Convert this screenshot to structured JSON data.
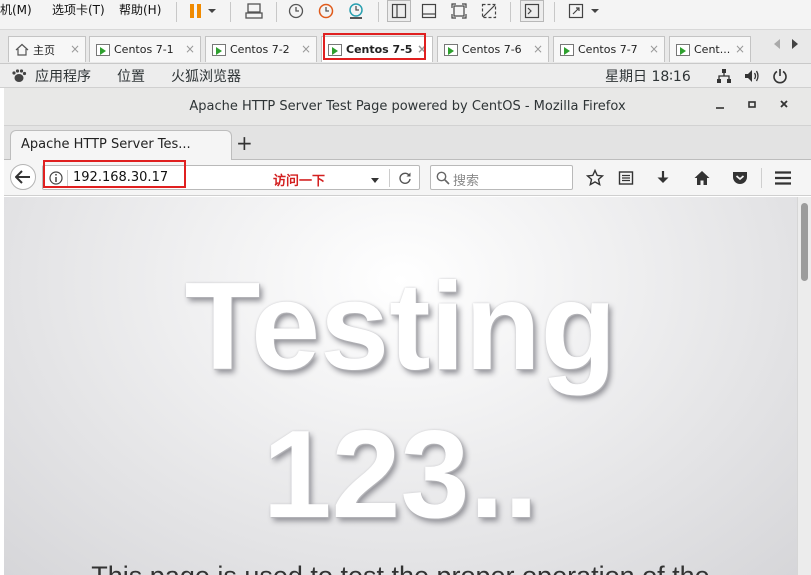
{
  "vmware": {
    "menus": [
      "机(M)",
      "选项卡(T)",
      "帮助(H)"
    ],
    "tabs": [
      {
        "label": "主页",
        "active": false
      },
      {
        "label": "Centos 7-1",
        "active": false
      },
      {
        "label": "Centos 7-2",
        "active": false
      },
      {
        "label": "Centos 7-5",
        "active": true
      },
      {
        "label": "Centos 7-6",
        "active": false
      },
      {
        "label": "Centos 7-7",
        "active": false
      },
      {
        "label": "Cent...",
        "active": false
      }
    ],
    "tab_close": "×"
  },
  "gnome": {
    "apps": "应用程序",
    "places": "位置",
    "browser": "火狐浏览器",
    "clock": "星期日 18∶16"
  },
  "firefox": {
    "window_title": "Apache HTTP Server Test Page powered by CentOS - Mozilla Firefox",
    "tab_title": "Apache HTTP Server Tes...",
    "new_tab": "+",
    "url": "192.168.30.17",
    "annotation": "访问一下",
    "search_placeholder": "搜索"
  },
  "page": {
    "heading_line1": "Testing",
    "heading_line2": "123..",
    "paragraph": "This page is used to test the proper operation of the"
  },
  "colors": {
    "annotation_red": "#e02020",
    "vm_accent": "#f08a00"
  }
}
